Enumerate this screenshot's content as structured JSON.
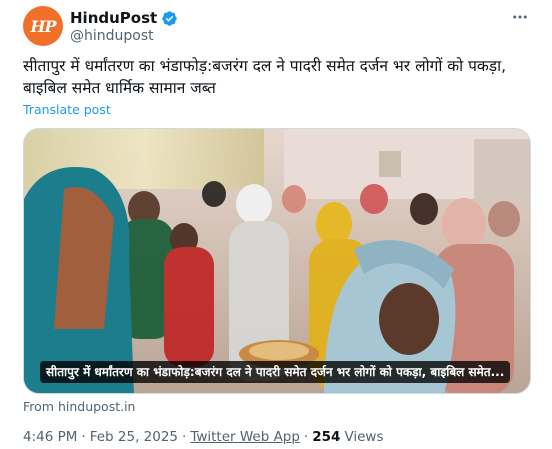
{
  "account": {
    "avatar_text": "HP",
    "display_name": "HinduPost",
    "handle": "@hindupost",
    "brand_color": "#f0702a",
    "verified_color": "#1d9bf0"
  },
  "tweet": {
    "text": "सीतापुर में धर्मांतरण का भंडाफोड़:बजरंग दल ने पादरी समेत दर्जन भर लोगों को पकड़ा, बाइबिल समेत धार्मिक सामान जब्त",
    "translate_label": "Translate post"
  },
  "media": {
    "caption": "सीतापुर में धर्मांतरण का भंडाफोड़:बजरंग दल ने पादरी समेत दर्जन भर लोगों को पकड़ा, बाइबिल समेत...",
    "source_label": "From hindupost.in"
  },
  "meta": {
    "time": "4:46 PM",
    "date": "Feb 25, 2025",
    "client": "Twitter Web App",
    "views_count": "254",
    "views_label": "Views"
  },
  "icons": {
    "more": "more-dots-icon",
    "verified": "verified-badge-icon"
  }
}
